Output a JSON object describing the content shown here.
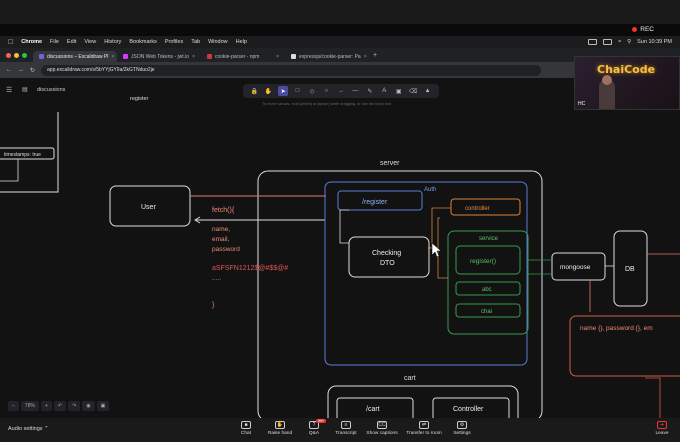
{
  "zoom": {
    "rec_label": "REC",
    "audio_settings": "Audio settings",
    "buttons": [
      {
        "label": "Chat",
        "icon": "chat-icon"
      },
      {
        "label": "Raise hand",
        "icon": "hand-icon"
      },
      {
        "label": "Q&A",
        "icon": "qa-icon",
        "badge": "99+"
      },
      {
        "label": "Transcript",
        "icon": "transcript-icon"
      },
      {
        "label": "Show captions",
        "icon": "captions-icon"
      },
      {
        "label": "Transfer to room",
        "icon": "transfer-icon"
      },
      {
        "label": "Settings",
        "icon": "gear-icon"
      },
      {
        "label": "Leave",
        "icon": "leave-icon"
      }
    ],
    "video_name": "HC",
    "video_logo": "ChaiCode"
  },
  "menubar": {
    "app": "Chrome",
    "items": [
      "File",
      "Edit",
      "View",
      "History",
      "Bookmarks",
      "Profiles",
      "Tab",
      "Window",
      "Help"
    ],
    "clock": "Sun 10:39 PM"
  },
  "browser": {
    "tabs": [
      {
        "title": "discussions – Excalidraw Pl",
        "active": true
      },
      {
        "title": "JSON Web Tokens - jwt.io",
        "active": false
      },
      {
        "title": "cookie-parser - npm",
        "active": false
      },
      {
        "title": "expressjs/cookie-parser: Pa",
        "active": false
      }
    ],
    "url": "app.excalidraw.com/s/5bYYjGY9a/2kGTNduo2je"
  },
  "excalidraw": {
    "file_label": "discussions",
    "hint": "To move canvas, hold [wheel] or [space] while dragging, or use the hand tool",
    "zoom_level": "78%",
    "tools": [
      "lock-icon",
      "hand-icon",
      "pointer-icon",
      "rectangle-icon",
      "diamond-icon",
      "ellipse-icon",
      "arrow-icon",
      "line-icon",
      "pencil-icon",
      "text-icon",
      "image-icon",
      "eraser-icon",
      "library-icon"
    ]
  },
  "diagram": {
    "register_label": "register",
    "timestamps_label": "timestamps: true",
    "server_label": "server",
    "user_label": "User",
    "fetch_label": "fetch(){",
    "fields": [
      "name,",
      "email,",
      "password"
    ],
    "token": "aSFSFN1212$@#$$@#",
    "dots": ".....",
    "close_brace": "}",
    "auth_label": "Auth",
    "register_route": "/register",
    "controller_label": "controller",
    "checking_dto_line1": "Checking",
    "checking_dto_line2": "DTO",
    "service_label": "service",
    "register_fn": "register()",
    "abc_label": "abc",
    "chai_label": "chai",
    "mongoose_label": "mongoose",
    "db_label": "DB",
    "schema_label": "name {}, password {}, em",
    "cart_label": "cart",
    "cart_route": "/cart",
    "cart_controller": "Controller"
  }
}
